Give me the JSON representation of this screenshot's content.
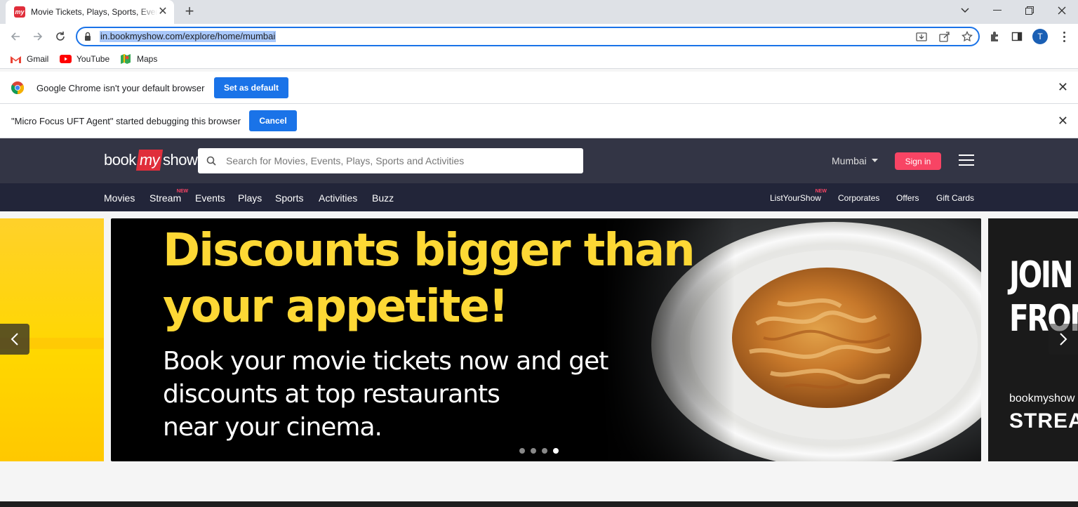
{
  "browser": {
    "tab_title": "Movie Tickets, Plays, Sports, Events & Cinemas",
    "url": "in.bookmyshow.com/explore/home/mumbai",
    "profile_initial": "T",
    "bookmarks": [
      "Gmail",
      "YouTube",
      "Maps"
    ],
    "infobar_default": {
      "message": "Google Chrome isn't your default browser",
      "button": "Set as default"
    },
    "infobar_debug": {
      "message": "\"Micro Focus UFT Agent\" started debugging this browser",
      "button": "Cancel"
    }
  },
  "site": {
    "logo": {
      "left": "book",
      "mid": "my",
      "right": "show"
    },
    "search_placeholder": "Search for Movies, Events, Plays, Sports and Activities",
    "city": "Mumbai",
    "signin": "Sign in",
    "nav_left": [
      "Movies",
      "Stream",
      "Events",
      "Plays",
      "Sports",
      "Activities",
      "Buzz"
    ],
    "nav_right": [
      "ListYourShow",
      "Corporates",
      "Offers",
      "Gift Cards"
    ],
    "new_badge": "NEW"
  },
  "banner": {
    "headline_line1": "Discounts bigger than",
    "headline_line2": "your appetite!",
    "sub_line1": "Book your movie tickets now and get",
    "sub_line2": "discounts at top restaurants",
    "sub_line3": "near your cinema.",
    "next_line1": "JOIN T",
    "next_line2": "FROM",
    "next_brand": "bookmyshow",
    "next_brand2": "STREAM",
    "active_slide": 4,
    "slide_count": 4
  },
  "colors": {
    "accent": "#f84464",
    "header": "#333545",
    "nav": "#222539",
    "headline": "#fdd835"
  }
}
